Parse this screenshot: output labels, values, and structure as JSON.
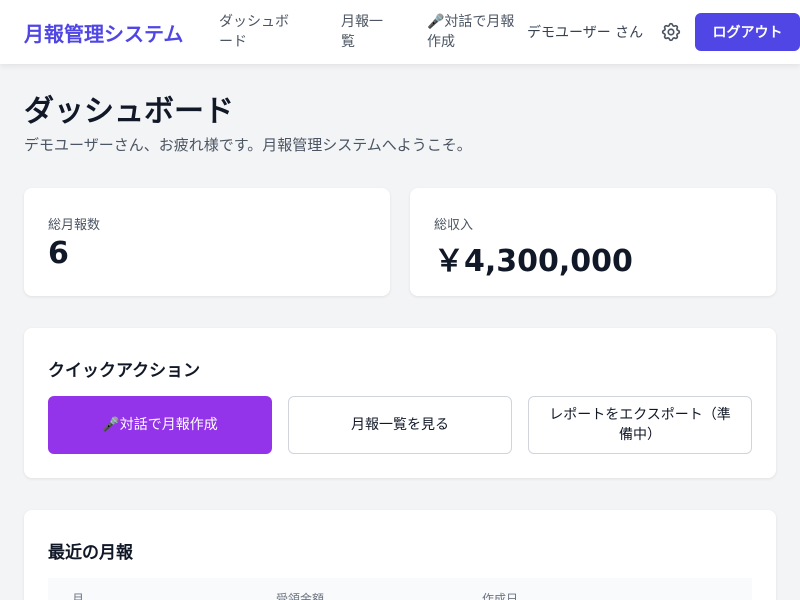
{
  "header": {
    "brand": "月報管理システム",
    "nav": [
      {
        "label": "ダッシュボード"
      },
      {
        "label": "月報一覧"
      },
      {
        "label": "🎤対話で月報作成"
      }
    ],
    "user_name": "デモユーザー さん",
    "settings_icon": "gear-icon",
    "logout_label": "ログアウト"
  },
  "page": {
    "title": "ダッシュボード",
    "subtitle": "デモユーザーさん、お疲れ様です。月報管理システムへようこそ。"
  },
  "stats": [
    {
      "label": "総月報数",
      "value": "6"
    },
    {
      "label": "総収入",
      "value": "￥4,300,000"
    }
  ],
  "quick_actions": {
    "title": "クイックアクション",
    "buttons": [
      {
        "label": "🎤対話で月報作成"
      },
      {
        "label": "月報一覧を見る"
      },
      {
        "label": "レポートをエクスポート（準備中）"
      }
    ]
  },
  "recent": {
    "title": "最近の月報",
    "columns": [
      "月",
      "受領金額",
      "作成日"
    ]
  },
  "colors": {
    "brand": "#4f46e5",
    "logout_button": "#4f46e5",
    "primary_action": "#9333ea",
    "background": "#f3f4f6"
  }
}
